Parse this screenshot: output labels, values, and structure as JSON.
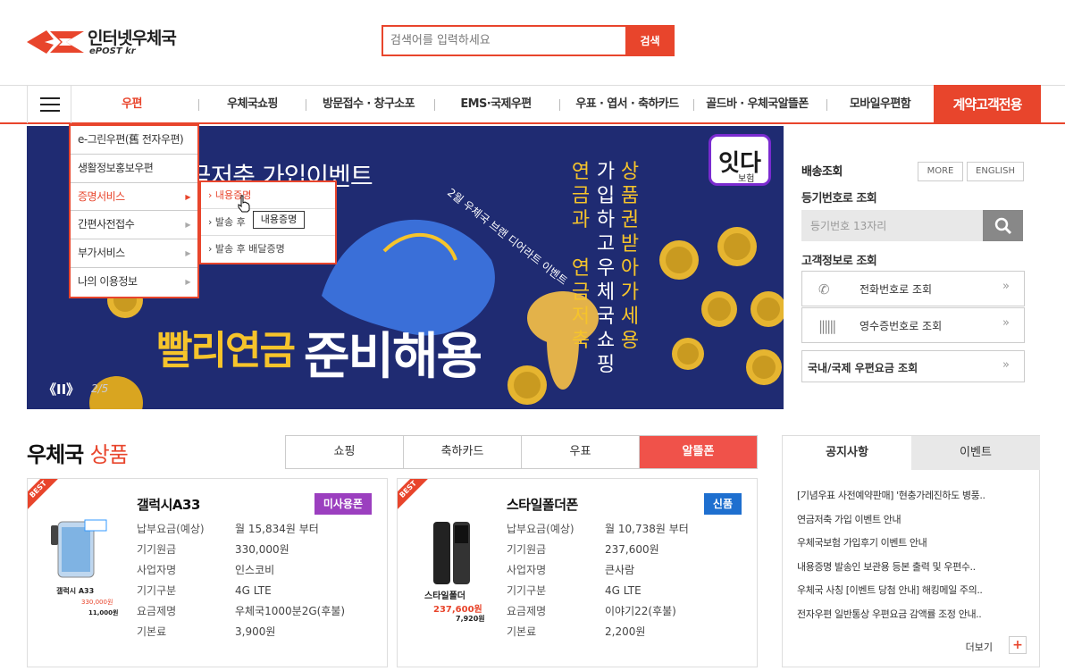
{
  "header": {
    "logo_title": "인터넷우체국",
    "logo_sub": "ePOST kr",
    "search_placeholder": "검색어를 입력하세요",
    "search_button": "검색"
  },
  "gnb": {
    "items": [
      "우편",
      "우체국쇼핑",
      "방문접수 · 창구소포",
      "EMS·국제우편",
      "우표 · 엽서 · 축하카드",
      "골드바 · 우체국알뜰폰",
      "모바일우편함"
    ],
    "special": "계약고객전용"
  },
  "dropdown": {
    "items": [
      "e-그린우편(舊 전자우편)",
      "생활정보홍보우편",
      "증명서비스",
      "간편사전접수",
      "부가서비스",
      "나의 이용정보"
    ],
    "submenu": [
      "내용증명",
      "발송 후",
      "발송 후 배달증명"
    ],
    "tooltip": "내용증명"
  },
  "banner": {
    "headline": "월 연금 · 연금저축 가입이벤트",
    "col1": [
      "연",
      "금",
      "과",
      "",
      "연",
      "금",
      "저",
      "축"
    ],
    "col2": [
      "가",
      "입",
      "하",
      "고",
      "우",
      "체",
      "국",
      "쇼",
      "핑"
    ],
    "col3": [
      "상",
      "품",
      "권",
      "받",
      "아",
      "가",
      "세",
      "용"
    ],
    "main_gold": "빨리연금",
    "main_white": "준비해용",
    "arc_text": "2월 우체국 브랜 디어라트 이벤트",
    "logo": "잇다",
    "logo_sub": "보험",
    "slide_ctrl": "《II》",
    "slide_count": "2/5"
  },
  "tracking": {
    "title": "배송조회",
    "more": "MORE",
    "english": "ENGLISH",
    "reg_label": "등기번호로 조회",
    "reg_placeholder": "등기번호 13자리",
    "customer_label": "고객정보로 조회",
    "phone": "전화번호로 조회",
    "receipt": "영수증번호로 조회",
    "rate": "국내/국제 우편요금 조회"
  },
  "products": {
    "title_main": "우체국",
    "title_accent": "상품",
    "tabs": [
      "쇼핑",
      "축하카드",
      "우표",
      "알뜰폰"
    ],
    "cards": [
      {
        "ribbon": "BEST",
        "name": "갤럭시A33",
        "badge": "미사용폰",
        "badge_color": "#9b3fbf",
        "specs": [
          {
            "k": "납부요금(예상)",
            "v": "월 15,834원 부터"
          },
          {
            "k": "기기원금",
            "v": "330,000원"
          },
          {
            "k": "사업자명",
            "v": "인스코비"
          },
          {
            "k": "기기구분",
            "v": "4G LTE"
          },
          {
            "k": "요금제명",
            "v": "우체국1000분2G(후불)"
          },
          {
            "k": "기본료",
            "v": "3,900원"
          }
        ],
        "img_caption": "갤럭시 A33",
        "img_price1": "330,000원",
        "img_price2": "11,000원"
      },
      {
        "ribbon": "BEST",
        "name": "스타일폴더폰",
        "badge": "신품",
        "badge_color": "#1e6fcf",
        "specs": [
          {
            "k": "납부요금(예상)",
            "v": "월 10,738원 부터"
          },
          {
            "k": "기기원금",
            "v": "237,600원"
          },
          {
            "k": "사업자명",
            "v": "큰사람"
          },
          {
            "k": "기기구분",
            "v": "4G LTE"
          },
          {
            "k": "요금제명",
            "v": "이야기22(후불)"
          },
          {
            "k": "기본료",
            "v": "2,200원"
          }
        ],
        "img_caption": "스타일폴더",
        "img_price1": "237,600원",
        "img_price2": "7,920원"
      }
    ]
  },
  "notice": {
    "tab_notice": "공지사항",
    "tab_event": "이벤트",
    "items": [
      "[기념우표 사전예약판매] '현충가레진하도 병풍..",
      "연금저축 가입 이벤트 안내",
      "우체국보험 가입후기 이벤트 안내",
      "내용증명 발송인 보관용 등본 출력 및 우편수..",
      "우체국 사칭 [이벤트 당첨 안내] 해킹메일 주의..",
      "전자우편 일반통상 우편요금 감액률 조정 안내.."
    ],
    "more": "더보기"
  },
  "colors": {
    "accent": "#e8452c",
    "banner_bg": "#1f2b72",
    "gold": "#f6c42b"
  }
}
